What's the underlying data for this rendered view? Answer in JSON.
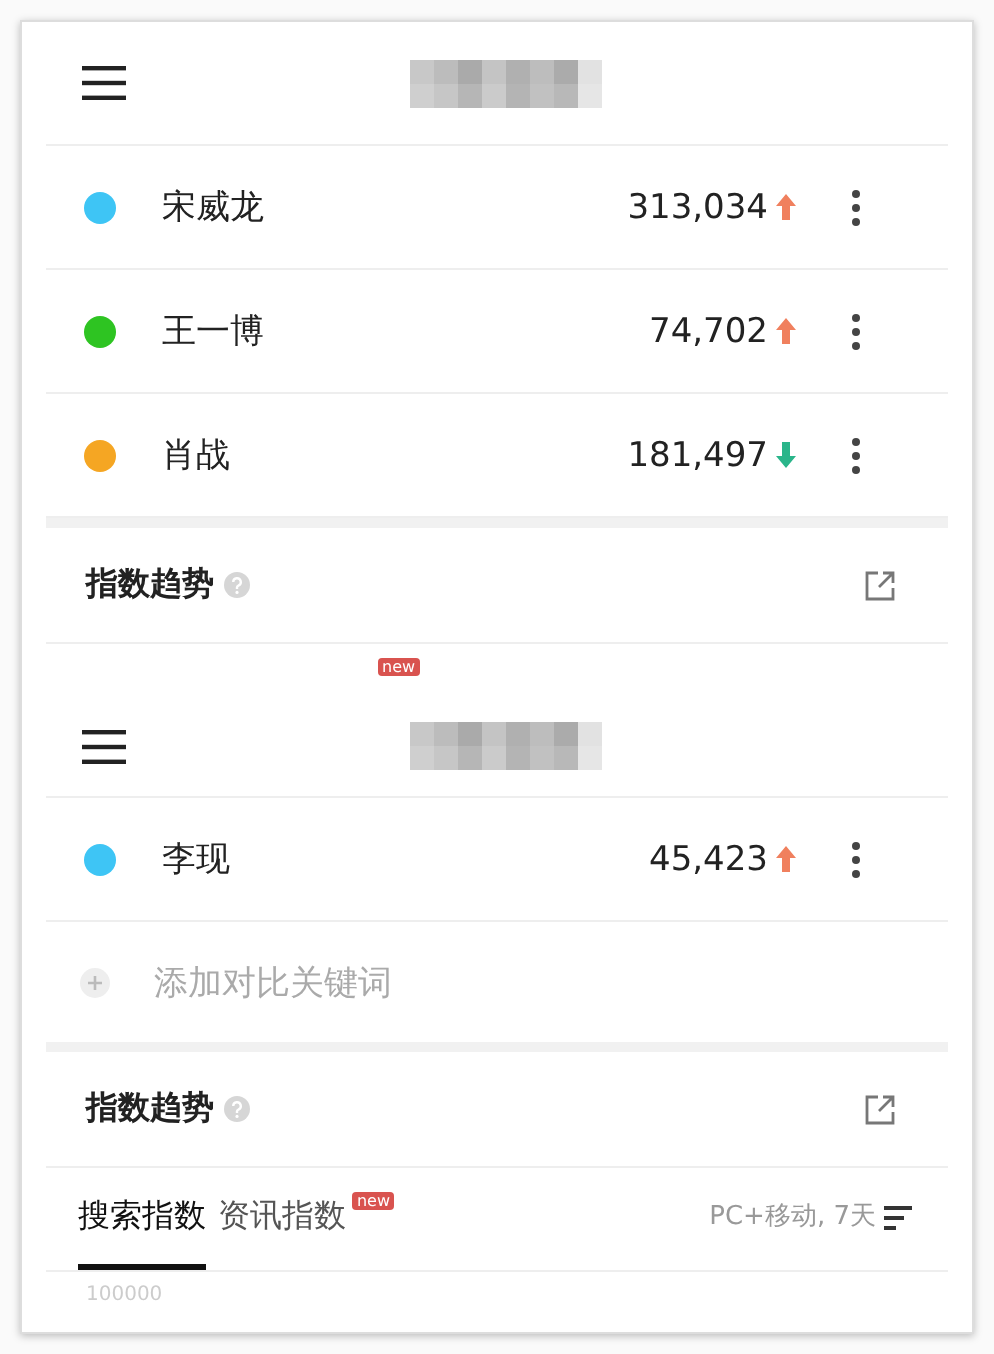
{
  "first_panel": {
    "keywords": [
      {
        "name": "宋威龙",
        "value": "313,034",
        "kind": "rising",
        "color": "#3ec5f5"
      },
      {
        "name": "王一博",
        "value": "74,702",
        "kind": "rising",
        "color": "#2ec422"
      },
      {
        "name": "肖战",
        "value": "181,497",
        "kind": "falling",
        "color": "#f5a623"
      }
    ]
  },
  "trend_section": {
    "title": "指数趋势"
  },
  "badge_fragment": "new",
  "second_panel": {
    "keywords": [
      {
        "name": "李现",
        "value": "45,423",
        "kind": "rising",
        "color": "#3ec5f5"
      }
    ],
    "add_keyword": "添加对比关键词"
  },
  "trend_section_2": {
    "title": "指数趋势",
    "tabs": [
      {
        "label": "搜索指数",
        "selected": true
      },
      {
        "label": "资讯指数",
        "selected": false,
        "badge": "new"
      }
    ],
    "filter": "PC+移动, 7天",
    "axis_label": "100000"
  }
}
